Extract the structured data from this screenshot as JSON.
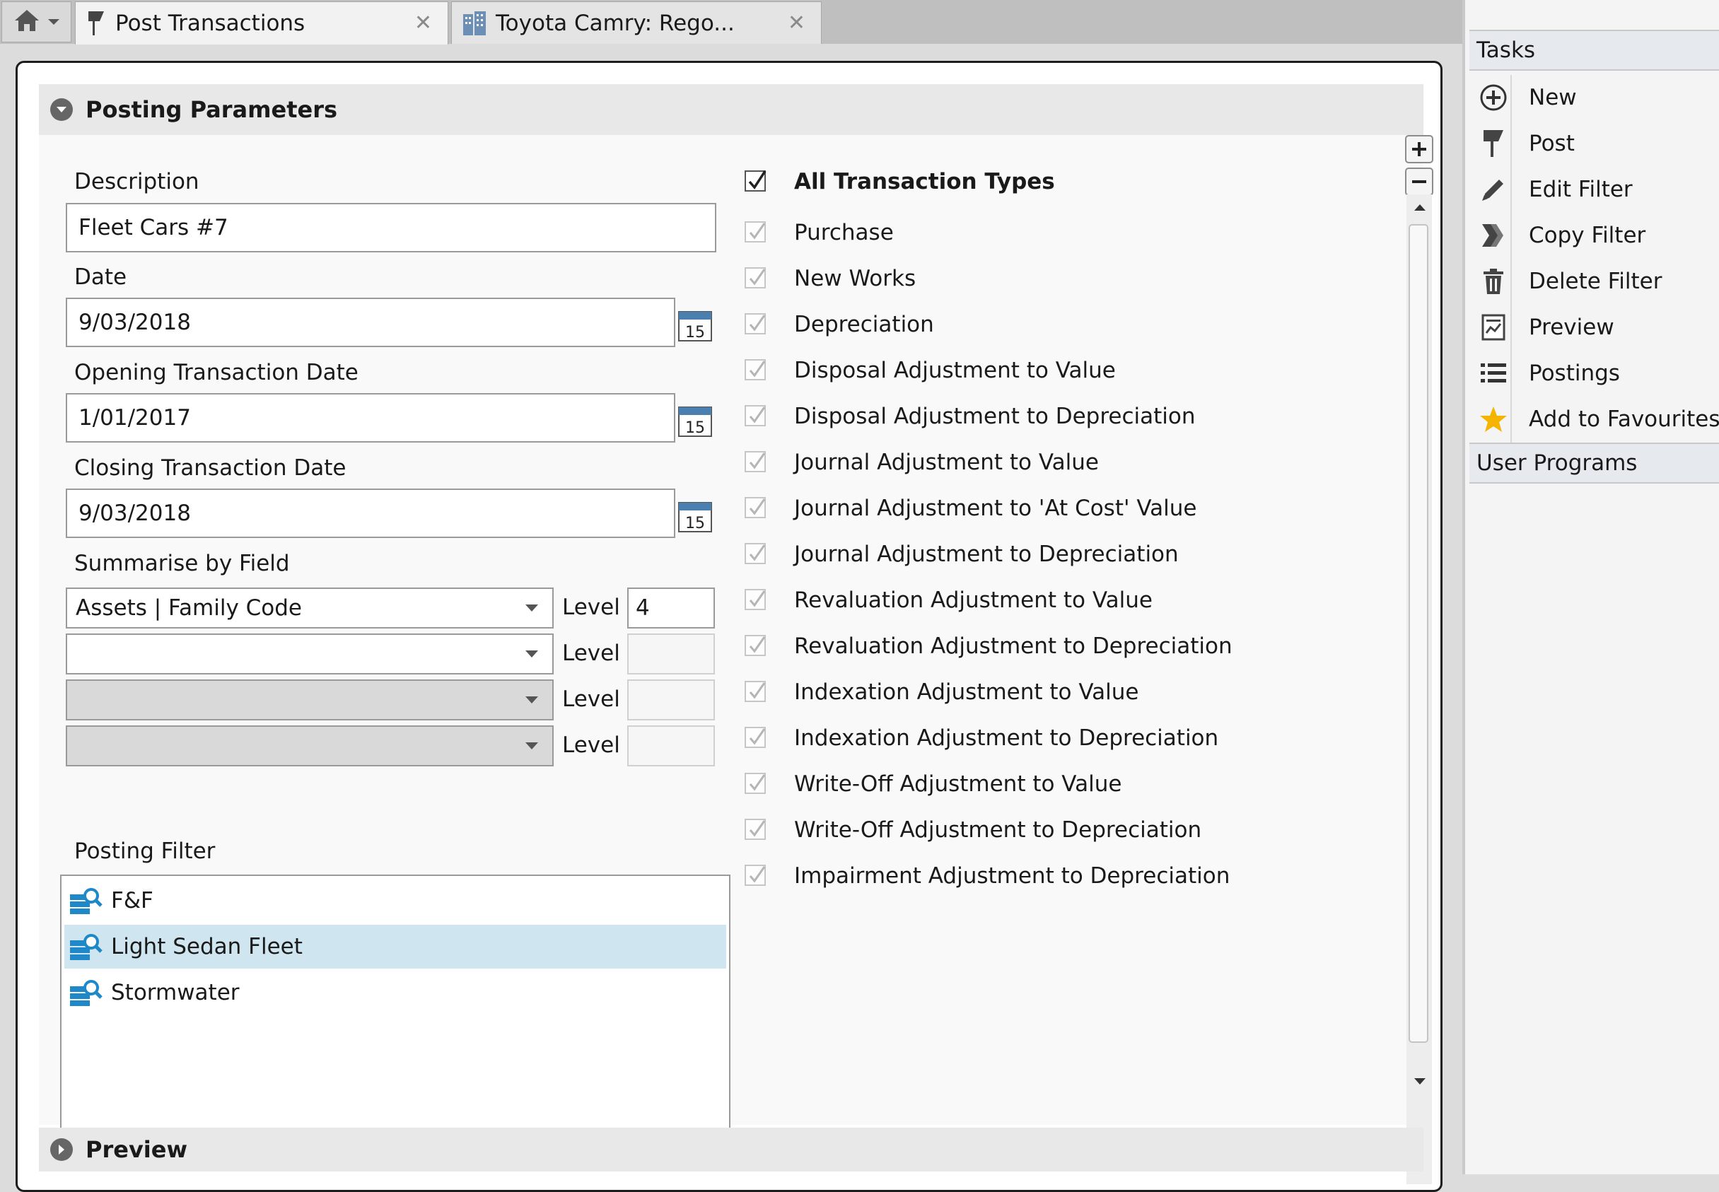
{
  "tabs": [
    {
      "label": "Post Transactions",
      "active": true
    },
    {
      "label": "Toyota Camry: Rego...",
      "active": false
    }
  ],
  "sections": {
    "posting_parameters": "Posting Parameters",
    "preview": "Preview"
  },
  "form": {
    "description": {
      "label": "Description",
      "value": "Fleet Cars #7"
    },
    "date": {
      "label": "Date",
      "value": "9/03/2018"
    },
    "opening_date": {
      "label": "Opening Transaction Date",
      "value": "1/01/2017"
    },
    "closing_date": {
      "label": "Closing Transaction Date",
      "value": "9/03/2018"
    },
    "calendar_day": "15",
    "summarise": {
      "label": "Summarise by Field",
      "level_label": "Level",
      "rows": [
        {
          "value": "Assets | Family Code",
          "level": "4",
          "enabled": true
        },
        {
          "value": "",
          "level": "",
          "enabled": true
        },
        {
          "value": "",
          "level": "",
          "enabled": false
        },
        {
          "value": "",
          "level": "",
          "enabled": false
        }
      ]
    },
    "posting_filter": {
      "label": "Posting Filter",
      "items": [
        "F&F",
        "Light Sedan Fleet",
        "Stormwater"
      ],
      "selected": "Light Sedan Fleet"
    }
  },
  "transaction_types": {
    "all_label": "All Transaction Types",
    "all_checked": true,
    "items": [
      "Purchase",
      "New Works",
      "Depreciation",
      "Disposal Adjustment to Value",
      "Disposal Adjustment to Depreciation",
      "Journal Adjustment to Value",
      "Journal Adjustment to 'At Cost' Value",
      "Journal Adjustment to Depreciation",
      "Revaluation Adjustment to Value",
      "Revaluation Adjustment to Depreciation",
      "Indexation Adjustment to Value",
      "Indexation Adjustment to Depreciation",
      "Write-Off Adjustment to Value",
      "Write-Off Adjustment to Depreciation",
      "Impairment Adjustment to Depreciation"
    ]
  },
  "tasks_panel": {
    "title": "Tasks",
    "items": [
      {
        "label": "New",
        "icon": "plus-circle-icon"
      },
      {
        "label": "Post",
        "icon": "pin-icon"
      },
      {
        "label": "Edit Filter",
        "icon": "pencil-icon"
      },
      {
        "label": "Copy Filter",
        "icon": "copy-icon"
      },
      {
        "label": "Delete Filter",
        "icon": "trash-icon"
      },
      {
        "label": "Preview",
        "icon": "preview-icon"
      },
      {
        "label": "Postings",
        "icon": "list-icon"
      },
      {
        "label": "Add to Favourites",
        "icon": "star-icon"
      }
    ],
    "user_programs": "User Programs"
  },
  "colors": {
    "selection": "#cfe5ef",
    "filter_icon": "#1e88c8",
    "star": "#f5b400"
  }
}
